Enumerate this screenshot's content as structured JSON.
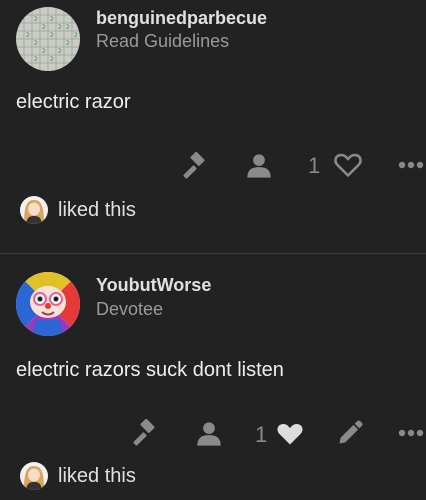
{
  "colors": {
    "background": "#222222",
    "text": "#eeeeee",
    "muted": "#9a9a9a",
    "icon": "#8a8a8a",
    "liked_heart": "#dddddd"
  },
  "posts": [
    {
      "username": "benguinedparbecue",
      "user_title": "Read Guidelines",
      "avatar_icon": "minesweeper-grid-avatar",
      "body": "electric razor",
      "actions": [
        "gavel-icon",
        "user-icon",
        "heart-outline-icon",
        "more-icon"
      ],
      "like_count": "1",
      "liked_by_text": "liked this"
    },
    {
      "username": "YoubutWorse",
      "user_title": "Devotee",
      "avatar_icon": "clown-character-avatar",
      "body": "electric razors suck dont listen",
      "actions": [
        "gavel-icon",
        "user-icon",
        "heart-filled-icon",
        "edit-icon",
        "more-icon"
      ],
      "like_count": "1",
      "liked_by_text": "liked this"
    }
  ]
}
